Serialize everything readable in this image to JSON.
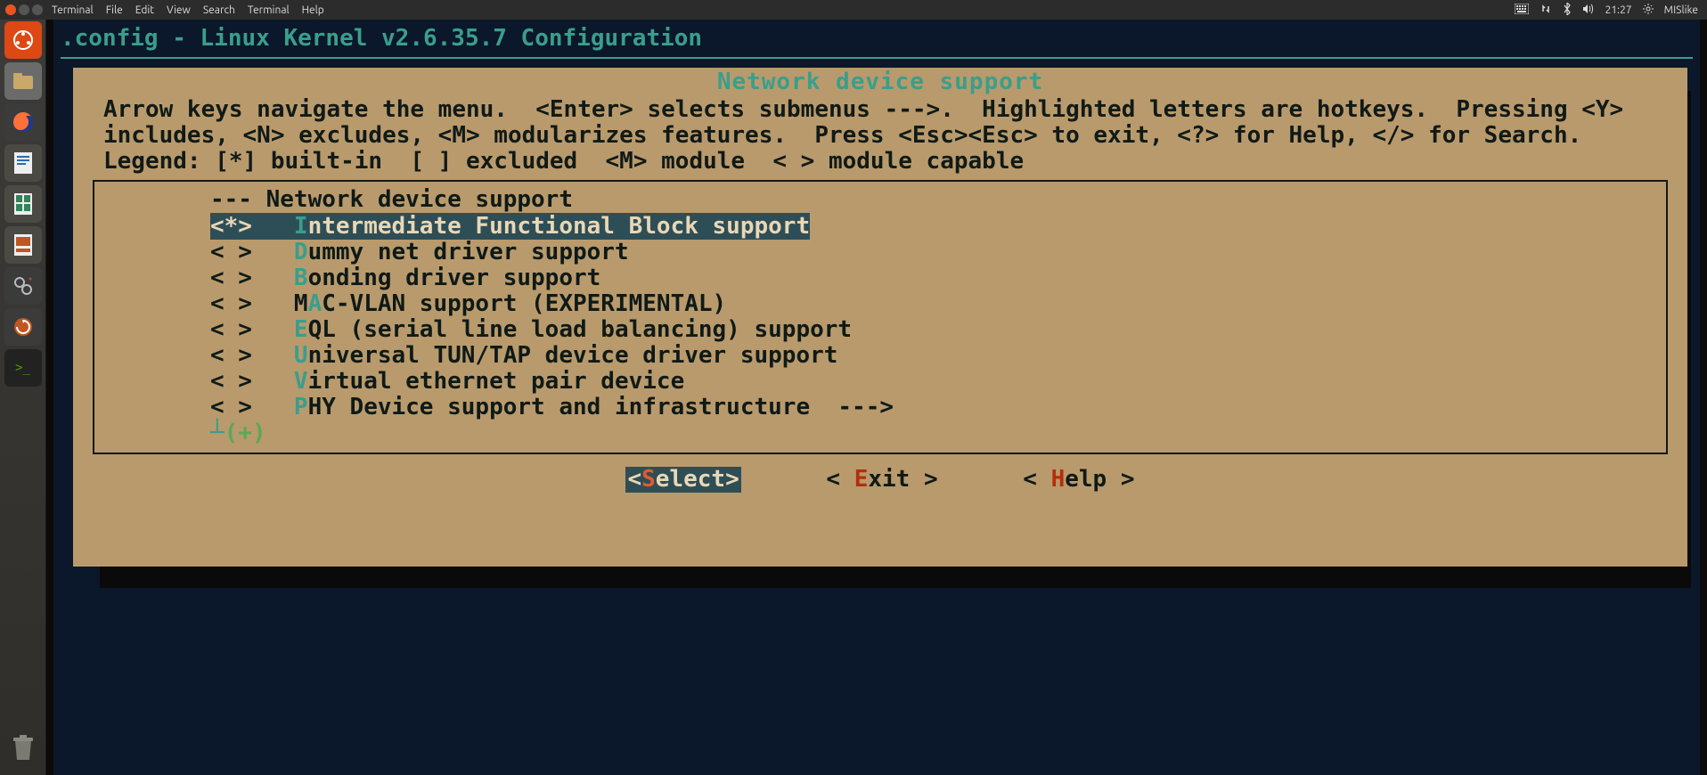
{
  "menubar": {
    "menus": [
      "Terminal",
      "File",
      "Edit",
      "View",
      "Search",
      "Terminal",
      "Help"
    ],
    "time": "21:27",
    "user": "MISlike"
  },
  "title": ".config - Linux Kernel v2.6.35.7 Configuration",
  "panel": {
    "title": "Network device support",
    "help": "Arrow keys navigate the menu.  <Enter> selects submenus --->.  Highlighted letters are hotkeys.  Pressing <Y> includes, <N> excludes, <M> modularizes features.  Press <Esc><Esc> to exit, <?> for Help, </> for Search.  Legend: [*] built-in  [ ] excluded  <M> module  < > module capable",
    "items": [
      {
        "state": "---",
        "hotkey": "",
        "rest": "Network device support",
        "selected": false,
        "header": true
      },
      {
        "state": "<*>",
        "hotkey": "I",
        "rest": "ntermediate Functional Block support",
        "selected": true
      },
      {
        "state": "< >",
        "hotkey": "D",
        "rest": "ummy net driver support",
        "selected": false
      },
      {
        "state": "< >",
        "hotkey": "B",
        "rest": "onding driver support",
        "selected": false
      },
      {
        "state": "< >",
        "hotkey": "A",
        "rest": "C-VLAN support (EXPERIMENTAL)",
        "selected": false,
        "prefix": "M"
      },
      {
        "state": "< >",
        "hotkey": "E",
        "rest": "QL (serial line load balancing) support",
        "selected": false
      },
      {
        "state": "< >",
        "hotkey": "U",
        "rest": "niversal TUN/TAP device driver support",
        "selected": false
      },
      {
        "state": "< >",
        "hotkey": "V",
        "rest": "irtual ethernet pair device",
        "selected": false
      },
      {
        "state": "< >",
        "hotkey": "P",
        "rest": "HY Device support and infrastructure  --->",
        "selected": false
      }
    ],
    "more": "(+)"
  },
  "buttons": {
    "select": {
      "label": "elect",
      "hk": "S",
      "selected": true
    },
    "exit": {
      "label": "xit",
      "hk": "E",
      "selected": false
    },
    "help": {
      "label": "elp",
      "hk": "H",
      "selected": false
    }
  },
  "colors": {
    "teal": "#3a9e8c",
    "panel_bg": "#b99a6c",
    "sel_bg": "#2e4e57",
    "sel_fg": "#e9d7b5",
    "hk_red": "#b22f0c"
  }
}
